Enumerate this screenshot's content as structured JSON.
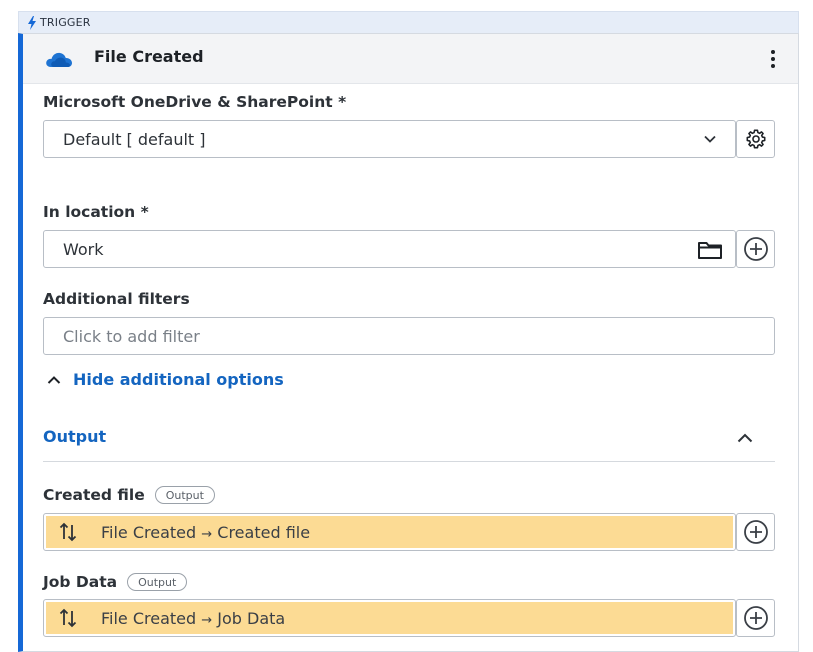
{
  "trigger": {
    "label": "TRIGGER"
  },
  "header": {
    "title": "File Created"
  },
  "connection": {
    "label": "Microsoft OneDrive & SharePoint *",
    "value": "Default [ default ]"
  },
  "location": {
    "label": "In location *",
    "value": "Work"
  },
  "filters": {
    "label": "Additional filters",
    "placeholder": "Click to add filter"
  },
  "options_link": {
    "label": "Hide additional options"
  },
  "output": {
    "title": "Output",
    "items": [
      {
        "name": "Created file",
        "badge": "Output",
        "source": "File Created",
        "arrow": "→",
        "field": "Created file"
      },
      {
        "name": "Job Data",
        "badge": "Output",
        "source": "File Created",
        "arrow": "→",
        "field": "Job Data"
      }
    ]
  },
  "colors": {
    "accent": "#1568d6",
    "link": "#1465c0",
    "mapping_highlight": "#fcdb94"
  }
}
